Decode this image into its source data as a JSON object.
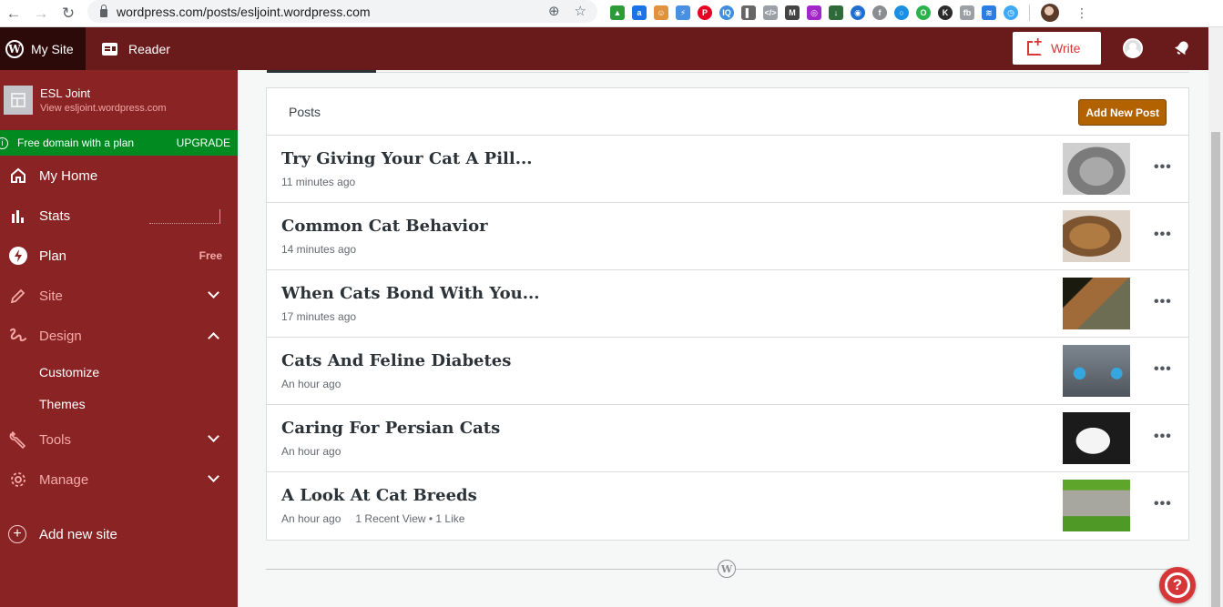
{
  "browser": {
    "url": "wordpress.com/posts/esljoint.wordpress.com",
    "back_icon": "←",
    "forward_icon": "→",
    "reload_icon": "↻",
    "zoom_icon": "⊕",
    "star_icon": "☆",
    "menu_icon": "⋮",
    "extensions": [
      {
        "name": "ext-triangles",
        "glyph": "▲",
        "color": "#2e9b3a"
      },
      {
        "name": "ext-amazon",
        "glyph": "a",
        "color": "#1a73e8"
      },
      {
        "name": "ext-monkey",
        "glyph": "☺",
        "color": "#e0923d"
      },
      {
        "name": "ext-bolt",
        "glyph": "⚡",
        "color": "#4a90e2"
      },
      {
        "name": "ext-pinterest",
        "glyph": "P",
        "color": "#e60023"
      },
      {
        "name": "ext-iq",
        "glyph": "IQ",
        "color": "#3f8fe0"
      },
      {
        "name": "ext-panel",
        "glyph": "▌",
        "color": "#666666"
      },
      {
        "name": "ext-code",
        "glyph": "</>",
        "color": "#9aa0a6"
      },
      {
        "name": "ext-m",
        "glyph": "M",
        "color": "#444444"
      },
      {
        "name": "ext-purple",
        "glyph": "◎",
        "color": "#a326c9"
      },
      {
        "name": "ext-download",
        "glyph": "↓",
        "color": "#2f6b3a"
      },
      {
        "name": "ext-feed",
        "glyph": "◉",
        "color": "#1f6fd1"
      },
      {
        "name": "ext-facebook",
        "glyph": "f",
        "color": "#8a8d91"
      },
      {
        "name": "ext-ring",
        "glyph": "○",
        "color": "#1a8fe3"
      },
      {
        "name": "ext-green",
        "glyph": "O",
        "color": "#2bb24c"
      },
      {
        "name": "ext-k",
        "glyph": "K",
        "color": "#2b2b2b"
      },
      {
        "name": "ext-fb",
        "glyph": "fb",
        "color": "#9aa0a6"
      },
      {
        "name": "ext-wave",
        "glyph": "≋",
        "color": "#2a7de1"
      },
      {
        "name": "ext-clock",
        "glyph": "◷",
        "color": "#3fa9f5"
      }
    ]
  },
  "masterbar": {
    "my_site": "My Site",
    "reader": "Reader",
    "write": "Write",
    "wp_glyph": "W",
    "bell_glyph": "🔔"
  },
  "sidebar": {
    "site_name": "ESL Joint",
    "site_url": "View esljoint.wordpress.com",
    "nudge_text": "Free domain with a plan",
    "nudge_action": "UPGRADE",
    "info_glyph": "i",
    "items": [
      {
        "label": "My Home",
        "icon": "⌂"
      },
      {
        "label": "Stats",
        "icon": "▮"
      },
      {
        "label": "Plan",
        "icon": "⚡",
        "badge": "Free"
      },
      {
        "label": "Site",
        "icon": "✎"
      },
      {
        "label": "Design",
        "icon": "ʑ"
      },
      {
        "label": "Tools",
        "icon": "🔧"
      },
      {
        "label": "Manage",
        "icon": "⚙"
      }
    ],
    "design_sub": [
      "Customize",
      "Themes"
    ],
    "add_site": "Add new site",
    "add_glyph": "+"
  },
  "posts": {
    "header": "Posts",
    "add_new": "Add New Post",
    "more_glyph": "•••",
    "items": [
      {
        "title": "Try Giving Your Cat A Pill...",
        "time": "11 minutes ago",
        "stats": ""
      },
      {
        "title": "Common Cat Behavior",
        "time": "14 minutes ago",
        "stats": ""
      },
      {
        "title": "When Cats Bond With You...",
        "time": "17 minutes ago",
        "stats": ""
      },
      {
        "title": "Cats And Feline Diabetes",
        "time": "An hour ago",
        "stats": ""
      },
      {
        "title": "Caring For Persian Cats",
        "time": "An hour ago",
        "stats": ""
      },
      {
        "title": "A Look At Cat Breeds",
        "time": "An hour ago",
        "stats": "1 Recent View • 1 Like"
      }
    ]
  },
  "footer": {
    "wp_glyph": "W"
  },
  "help": {
    "glyph": "?"
  },
  "colors": {
    "masterbar": "#691b1b",
    "sidebar": "#8a2424",
    "nudge": "#008a20",
    "add_post": "#b26200",
    "write": "#d63638"
  }
}
